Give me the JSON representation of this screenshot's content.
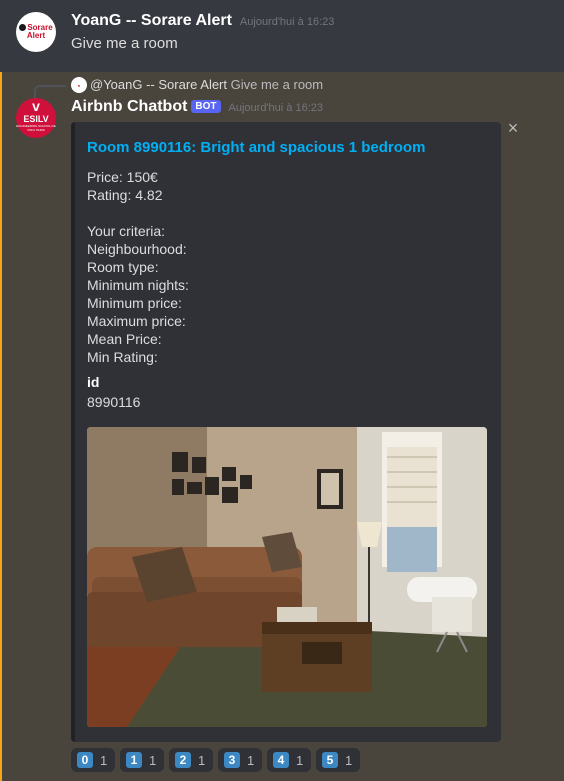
{
  "message1": {
    "author": "YoanG -- Sorare Alert",
    "timestamp": "Aujourd'hui à 16:23",
    "content": "Give me a room",
    "avatar_text": "Sorare Alert"
  },
  "message2": {
    "reply": {
      "author": "@YoanG -- Sorare Alert",
      "content": "Give me a room"
    },
    "author": "Airbnb Chatbot",
    "bot_tag": "BOT",
    "timestamp": "Aujourd'hui à 16:23",
    "avatar_text": "ESILV",
    "avatar_subtext": "ENGINEERING SCHOOL DE VINCI PARIS",
    "embed": {
      "title": "Room 8990116: Bright and spacious 1 bedroom",
      "description": [
        "Price: 150€",
        "Rating: 4.82",
        "",
        "Your criteria:",
        "Neighbourhood:",
        "Room type:",
        "Minimum nights:",
        "Minimum price:",
        "Maximum price:",
        "Mean Price:",
        "Min Rating:"
      ],
      "field": {
        "name": "id",
        "value": "8990116"
      },
      "close_icon": "×"
    },
    "reactions": [
      {
        "emoji": "0",
        "count": "1"
      },
      {
        "emoji": "1",
        "count": "1"
      },
      {
        "emoji": "2",
        "count": "1"
      },
      {
        "emoji": "3",
        "count": "1"
      },
      {
        "emoji": "4",
        "count": "1"
      },
      {
        "emoji": "5",
        "count": "1"
      }
    ]
  },
  "colors": {
    "background": "#36393f",
    "highlight": "#49443c",
    "mention_bar": "#faa61a",
    "embed_bg": "#2f3136",
    "link": "#00aff4",
    "bot_tag": "#5865f2",
    "keycap": "#3b88c3"
  }
}
